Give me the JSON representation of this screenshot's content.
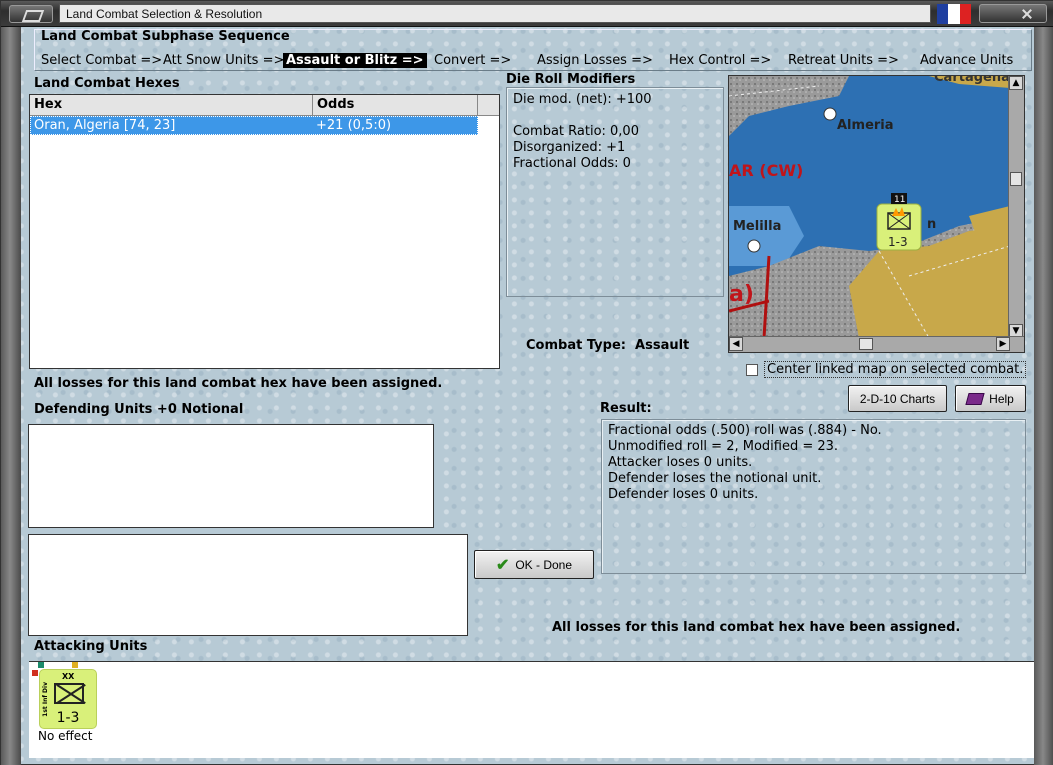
{
  "window": {
    "title": "Land Combat Selection & Resolution",
    "flag_colors": [
      "#1f3fa0",
      "#ffffff",
      "#d22"
    ]
  },
  "subphase": {
    "title": "Land Combat Subphase Sequence",
    "steps": [
      "Select Combat =>",
      "Att Snow Units =>",
      "Assault or Blitz =>",
      "Convert =>",
      "Assign Losses =>",
      "Hex Control =>",
      "Retreat Units =>",
      "Advance Units"
    ],
    "active_step": "Assault or Blitz =>"
  },
  "land_combat_hexes": {
    "label": "Land Combat Hexes",
    "columns": [
      "Hex",
      "Odds"
    ],
    "rows": [
      {
        "hex": "Oran, Algeria [74, 23]",
        "odds": "+21 (0,5:0)"
      }
    ]
  },
  "die_roll": {
    "label": "Die Roll Modifiers",
    "lines": [
      "Die mod. (net): +100",
      "",
      "Combat Ratio: 0,00",
      "Disorganized: +1",
      "Fractional Odds: 0"
    ]
  },
  "map": {
    "labels": {
      "almeria": "Almeria",
      "melilla": "Melilla",
      "region": "AR (CW)",
      "cartagena": "Cartagena",
      "partial": "a)",
      "hex_n": "n"
    },
    "unit_count": "11",
    "unit_strength": "1-3",
    "sea_color": "#2b6fb1",
    "land_color": "#c8a84a"
  },
  "combat_type": {
    "label": "Combat Type:",
    "value": "Assault"
  },
  "center_map": {
    "label": "Center linked map on selected combat.",
    "checked": false
  },
  "buttons": {
    "charts": "2-D-10 Charts",
    "help": "Help",
    "ok": "OK - Done"
  },
  "losses_msg_top": "All losses for this land combat hex have been assigned.",
  "defending": {
    "label": "Defending Units +0 Notional"
  },
  "result": {
    "label": "Result:",
    "lines": [
      "Fractional odds (.500) roll was (.884)  - No.",
      "Unmodified roll = 2, Modified = 23.",
      "Attacker loses 0 units.",
      "Defender loses the notional unit.",
      "Defender loses 0 units."
    ]
  },
  "losses_msg_bottom": "All losses for this land combat hex have been assigned.",
  "attacking": {
    "label": "Attacking Units",
    "unit": {
      "side_label": "1st Inf Div",
      "type": "XX",
      "strength": "1-3",
      "status": "No effect"
    }
  }
}
